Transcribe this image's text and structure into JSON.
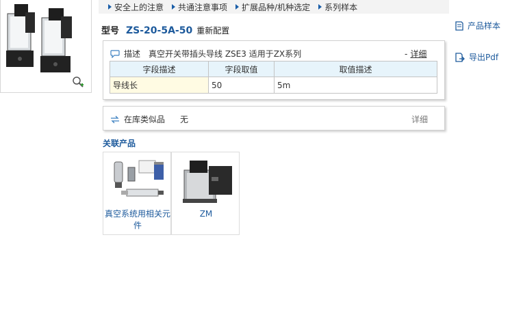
{
  "breadcrumb": {
    "items": [
      "安全上的注意",
      "共通注意事项",
      "扩展品种/机种选定",
      "系列样本"
    ]
  },
  "model": {
    "label": "型号",
    "code": "ZS-20-5A-50",
    "reconfigure": "重新配置"
  },
  "description_panel": {
    "title": "描述",
    "text": "真空开关带插头导线 ZSE3 适用于ZX系列",
    "collapse_prefix": "-",
    "collapse_link": "详细",
    "table": {
      "headers": [
        "字段描述",
        "字段取值",
        "取值描述"
      ],
      "rows": [
        [
          "导线长",
          "50",
          "5m"
        ]
      ]
    }
  },
  "stock_panel": {
    "label": "在库类似品",
    "value": "无",
    "detail": "详细"
  },
  "related": {
    "title": "关联产品",
    "items": [
      {
        "label": "真空系统用相关元件",
        "icon": "vacuum-components-image"
      },
      {
        "label": "ZM",
        "icon": "zm-ejector-image"
      }
    ]
  },
  "side_links": {
    "catalog": "产品样本",
    "export_pdf": "导出Pdf"
  },
  "colors": {
    "link_blue": "#1d5a9c",
    "table_header_bg": "#e7f4fb",
    "first_cell_bg": "#fffbe3"
  }
}
